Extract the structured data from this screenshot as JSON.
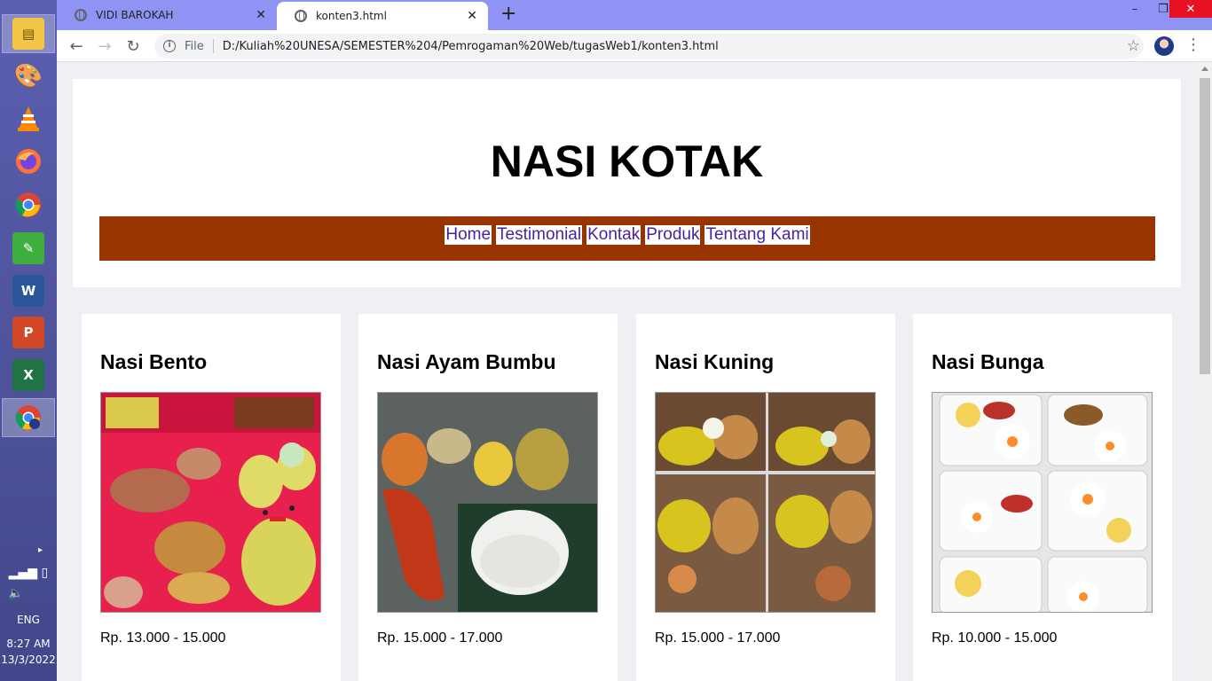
{
  "browser": {
    "tabs": [
      {
        "title": "VIDI BAROKAH",
        "active": false
      },
      {
        "title": "konten3.html",
        "active": true
      }
    ],
    "address_scheme": "File",
    "address_url": "D:/Kuliah%20UNESA/SEMESTER%204/Pemrogaman%20Web/tugasWeb1/konten3.html"
  },
  "taskbar": {
    "language": "ENG",
    "time": "8:27 AM",
    "date": "13/3/2022",
    "apps": [
      "file-explorer-icon",
      "paint-icon",
      "vlc-icon",
      "firefox-icon",
      "chrome-icon",
      "corel-icon",
      "word-icon",
      "powerpoint-icon",
      "excel-icon",
      "chrome-profile-icon"
    ]
  },
  "page": {
    "title": "NASI KOTAK",
    "nav": [
      "Home",
      "Testimonial",
      "Kontak",
      "Produk",
      "Tentang Kami"
    ],
    "products": [
      {
        "name": "Nasi Bento",
        "price": "Rp. 13.000 - 15.000"
      },
      {
        "name": "Nasi Ayam Bumbu",
        "price": "Rp. 15.000 - 17.000"
      },
      {
        "name": "Nasi Kuning",
        "price": "Rp. 15.000 - 17.000"
      },
      {
        "name": "Nasi Bunga",
        "price": "Rp. 10.000 - 15.000"
      }
    ]
  },
  "colors": {
    "nav_bg": "#993300",
    "tabstrip": "#8f93f4",
    "nav_link": "#4b1fa0"
  }
}
